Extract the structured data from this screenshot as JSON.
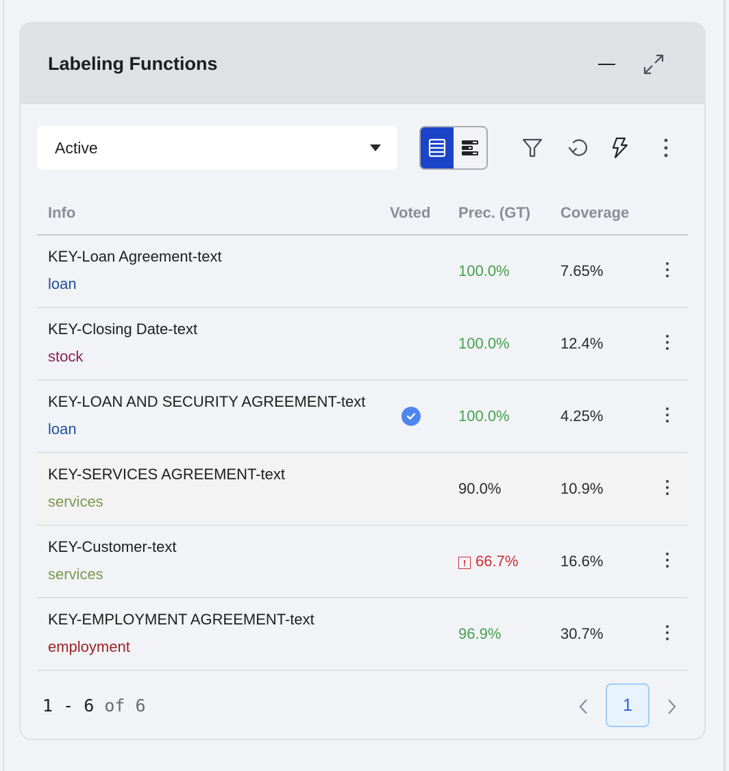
{
  "panel": {
    "title": "Labeling Functions",
    "header_icons": [
      "minimize-icon",
      "expand-icon"
    ]
  },
  "toolbar": {
    "status_select": {
      "value": "Active"
    },
    "view_toggle": {
      "options": [
        "table-view-icon",
        "chart-view-icon"
      ],
      "active": "table-view-icon"
    },
    "actions": [
      "filter-icon",
      "refresh-icon",
      "lightning-icon",
      "more-vertical-icon"
    ]
  },
  "table": {
    "columns": [
      "Info",
      "Voted",
      "Prec. (GT)",
      "Coverage"
    ],
    "rows": [
      {
        "title": "KEY-Loan Agreement-text",
        "label": "loan",
        "label_color": "#1f4f9c",
        "voted": false,
        "precision": "100.0%",
        "precision_status": "good",
        "coverage": "7.65%"
      },
      {
        "title": "KEY-Closing Date-text",
        "label": "stock",
        "label_color": "#8c2150",
        "voted": false,
        "precision": "100.0%",
        "precision_status": "good",
        "coverage": "12.4%"
      },
      {
        "title": "KEY-LOAN AND SECURITY AGREEMENT-text",
        "label": "loan",
        "label_color": "#1f4f9c",
        "voted": true,
        "precision": "100.0%",
        "precision_status": "good",
        "coverage": "4.25%"
      },
      {
        "title": "KEY-SERVICES AGREEMENT-text",
        "label": "services",
        "label_color": "#7a9a4e",
        "voted": false,
        "precision": "90.0%",
        "precision_status": "neutral",
        "coverage": "10.9%"
      },
      {
        "title": "KEY-Customer-text",
        "label": "services",
        "label_color": "#7a9a4e",
        "voted": false,
        "precision": "66.7%",
        "precision_status": "warning",
        "coverage": "16.6%"
      },
      {
        "title": "KEY-EMPLOYMENT AGREEMENT-text",
        "label": "employment",
        "label_color": "#9c2424",
        "voted": false,
        "precision": "96.9%",
        "precision_status": "good",
        "coverage": "30.7%"
      }
    ]
  },
  "colors": {
    "good": "#44a04c",
    "neutral": "#2a2a2a",
    "warning": "#c83030",
    "accent": "#1b44c8"
  },
  "pagination": {
    "range": "1 - 6",
    "of_label": "of 6",
    "current_page": "1"
  }
}
